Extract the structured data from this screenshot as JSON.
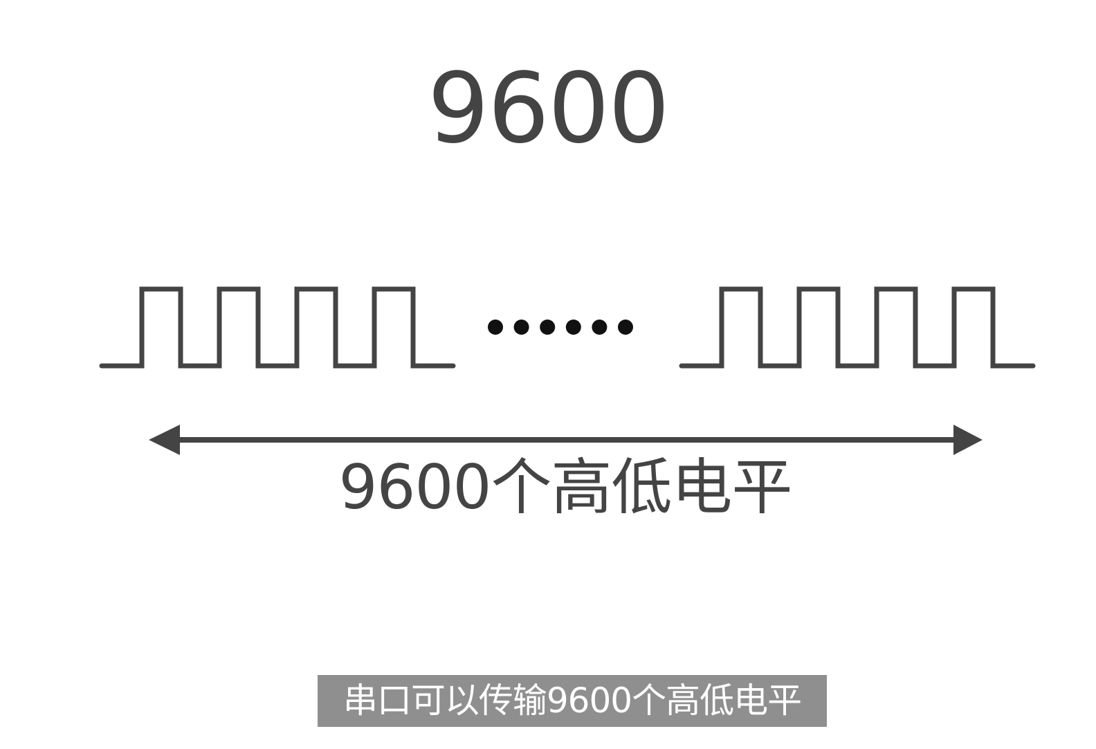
{
  "title": "9600",
  "signal": {
    "left_group_pulses": 4,
    "right_group_pulses": 4,
    "ellipsis": "……",
    "line_color": "#444444",
    "dot_color": "#111111"
  },
  "span_label": "9600个高低电平",
  "subtitle": "串口可以传输9600个高低电平"
}
